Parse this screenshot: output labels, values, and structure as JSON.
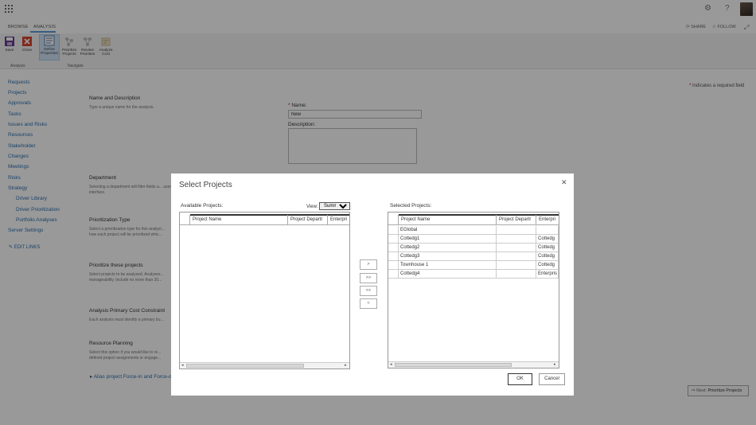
{
  "ribbon_tabs": {
    "browse": "BROWSE",
    "analysis": "ANALYSIS"
  },
  "topbar": {
    "share": "SHARE",
    "follow": "FOLLOW"
  },
  "ribbon": {
    "save": "Save",
    "close": "Close",
    "define": "Define Properties",
    "prioritize": "Prioritize Projects",
    "review": "Review Priorities",
    "analyze": "Analyze Cost",
    "group_analysis": "Analysis",
    "group_navigate": "Navigate"
  },
  "nav": {
    "items": [
      "Requests",
      "Projects",
      "Approvals",
      "Tasks",
      "Issues and Risks",
      "Resources",
      "Stakeholder",
      "Changes",
      "Meetings",
      "Risks",
      "Strategy"
    ],
    "sub_items": [
      "Driver Library",
      "Driver Prioritization",
      "Portfolio Analyses"
    ],
    "server_settings": "Server Settings",
    "edit_links": "EDIT LINKS"
  },
  "form": {
    "required_note": "Indicates a required field",
    "name_desc_title": "Name and Description",
    "name_desc_text": "Type a unique name for the analysis.",
    "name_label": "Name:",
    "name_value": "New",
    "description_label": "Description:",
    "department_title": "Department",
    "department_text": "Selecting a department will filter fields a... user interface.",
    "prio_type_title": "Prioritization Type",
    "prio_type_text": "Select a prioritization type for this analysi... how each project will be prioritized whic...",
    "prio_projects_title": "Prioritize these projects",
    "prio_projects_text": "Select projects to be analyzed. Analyses... manageability. Include no more than 20...",
    "cost_title": "Analysis Primary Cost Constraint",
    "cost_text": "Each analysis must identify a primary bu...",
    "resource_title": "Resource Planning",
    "resource_text": "Select this option if you would like to re... defined project assignments or engage...",
    "alias_link": "Alias project Force-in and Force-o...",
    "next_prefix": "Next:",
    "next_label": "Prioritize Projects"
  },
  "dialog": {
    "title": "Select Projects",
    "available_label": "Available Projects:",
    "view_label": "View:",
    "view_value": "Summary",
    "selected_label": "Selected Projects:",
    "columns": [
      "Project Name",
      "Project Departr",
      "Enterpri"
    ],
    "selected_rows": [
      {
        "name": "EGlobal",
        "dept": "",
        "ent": ""
      },
      {
        "name": "Cottedg1",
        "dept": "",
        "ent": "Cottedg"
      },
      {
        "name": "Cottedg2",
        "dept": "",
        "ent": "Cottedg"
      },
      {
        "name": "Cottedg3",
        "dept": "",
        "ent": "Cottedg"
      },
      {
        "name": "Townhouse 1",
        "dept": "",
        "ent": "Cottedg"
      },
      {
        "name": "Cottedg4",
        "dept": "",
        "ent": "Enterpris"
      }
    ],
    "move_buttons": [
      ">",
      ">>",
      "<<",
      "<"
    ],
    "ok": "OK",
    "cancel": "Cancel"
  }
}
